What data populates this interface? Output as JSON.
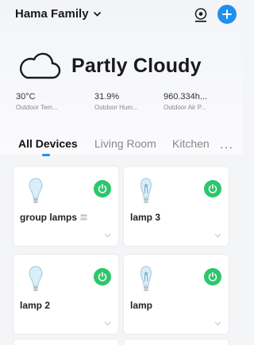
{
  "header": {
    "home_name": "Hama Family",
    "chevron_icon": "chevron-down-icon",
    "camera_icon": "camera-icon",
    "add_icon": "plus-icon",
    "accent_color": "#1e90f0"
  },
  "weather": {
    "icon": "cloud-icon",
    "condition": "Partly Cloudy",
    "stats": [
      {
        "value": "30°C",
        "label": "Outdoor Tem..."
      },
      {
        "value": "31.9%",
        "label": "Outdoor Hum..."
      },
      {
        "value": "960.334h...",
        "label": "Outdoor Air P..."
      }
    ]
  },
  "tabs": {
    "items": [
      "All Devices",
      "Living Room",
      "Kitchen"
    ],
    "active": "All Devices",
    "more_label": "···"
  },
  "devices": [
    {
      "name": "group lamps",
      "icon": "bulb-icon",
      "power": "on",
      "group": true
    },
    {
      "name": "lamp 3",
      "icon": "filament-bulb-icon",
      "power": "on",
      "group": false
    },
    {
      "name": "lamp 2",
      "icon": "bulb-icon",
      "power": "on",
      "group": false
    },
    {
      "name": "lamp",
      "icon": "filament-bulb-icon",
      "power": "on",
      "group": false
    }
  ],
  "power_color": "#2cc66c"
}
